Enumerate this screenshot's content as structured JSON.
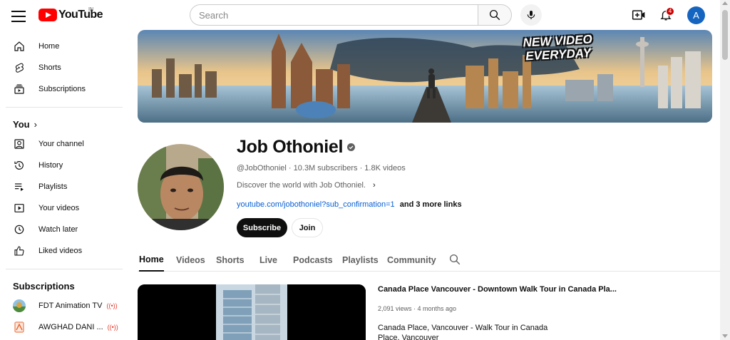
{
  "header": {
    "logo_text": "YouTube",
    "country_code": "IN",
    "search_placeholder": "Search",
    "notification_count": "4",
    "avatar_letter": "A"
  },
  "sidebar": {
    "main_items": [
      {
        "label": "Home",
        "icon": "home-icon"
      },
      {
        "label": "Shorts",
        "icon": "shorts-icon"
      },
      {
        "label": "Subscriptions",
        "icon": "subscriptions-icon"
      }
    ],
    "you_heading": "You",
    "you_items": [
      {
        "label": "Your channel",
        "icon": "your-channel-icon"
      },
      {
        "label": "History",
        "icon": "history-icon"
      },
      {
        "label": "Playlists",
        "icon": "playlists-icon"
      },
      {
        "label": "Your videos",
        "icon": "your-videos-icon"
      },
      {
        "label": "Watch later",
        "icon": "watch-later-icon"
      },
      {
        "label": "Liked videos",
        "icon": "liked-videos-icon"
      }
    ],
    "subscriptions_heading": "Subscriptions",
    "subscriptions": [
      {
        "name": "FDT Animation TV",
        "live": true
      },
      {
        "name": "AWGHAD DANI ...",
        "live": true
      }
    ]
  },
  "channel": {
    "banner_tagline_line1": "NEW VIDEO",
    "banner_tagline_line2": "EVERYDAY",
    "name": "Job Othoniel",
    "meta": "@JobOthoniel · 10.3M subscribers · 1.8K videos",
    "description": "Discover the world with Job Othoniel.",
    "link": "youtube.com/jobothoniel?sub_confirmation=1",
    "more_links": "and 3 more links",
    "subscribe_label": "Subscribe",
    "join_label": "Join"
  },
  "tabs": [
    "Home",
    "Videos",
    "Shorts",
    "Live",
    "Podcasts",
    "Playlists",
    "Community"
  ],
  "active_tab": "Home",
  "featured_video": {
    "title": "Canada Place Vancouver - Downtown Walk Tour in Canada Pla...",
    "meta": "2,091 views · 4 months ago",
    "description": "Canada Place, Vancouver - Walk Tour in Canada Place, Vancouver"
  },
  "colors": {
    "brand_red": "#ff0000",
    "link_blue": "#065fd4",
    "avatar_blue": "#1565c0",
    "badge_red": "#cc0000"
  }
}
